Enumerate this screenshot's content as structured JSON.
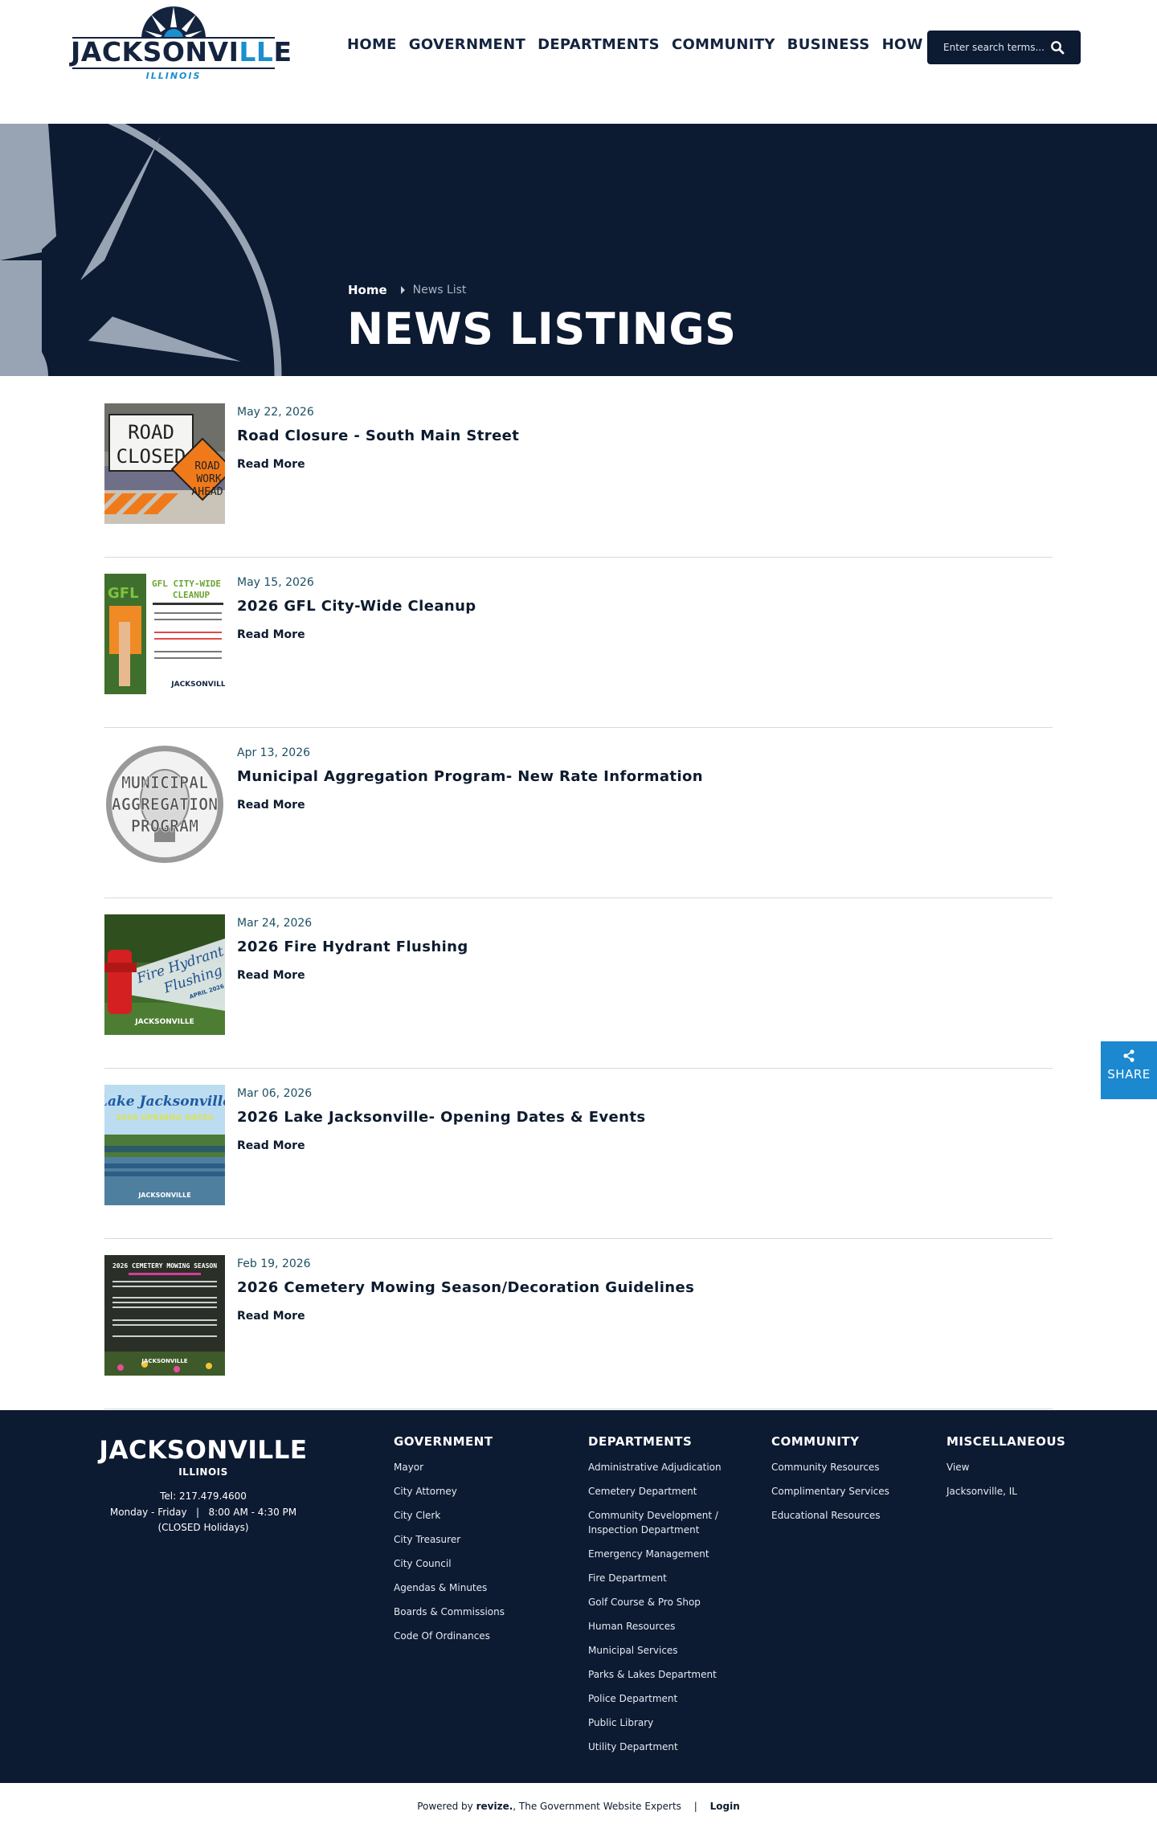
{
  "header": {
    "logo_word_a": "JACKSONVI",
    "logo_word_b": "LL",
    "logo_word_c": "E",
    "logo_sub": "ILLINOIS",
    "nav": [
      "HOME",
      "GOVERNMENT",
      "DEPARTMENTS",
      "COMMUNITY",
      "BUSINESS",
      "HOW DO I"
    ],
    "search_placeholder": "Enter search terms..."
  },
  "hero": {
    "breadcrumb_home": "Home",
    "breadcrumb_current": "News List",
    "title": "NEWS LISTINGS"
  },
  "news": [
    {
      "date": "May 22, 2026",
      "title": "Road Closure - South Main Street",
      "more": "Read More",
      "thumb_text": [
        "ROAD",
        "CLOSED",
        "ROAD",
        "WORK",
        "AHEAD"
      ]
    },
    {
      "date": "May 15, 2026",
      "title": "2026 GFL City-Wide Cleanup",
      "more": "Read More",
      "thumb_text": [
        "GFL CITY-WIDE",
        "CLEANUP",
        "JACKSONVILLE"
      ]
    },
    {
      "date": "Apr 13, 2026",
      "title": "Municipal Aggregation Program- New Rate Information",
      "more": "Read More",
      "thumb_text": [
        "MUNICIPAL",
        "AGGREGATION",
        "PROGRAM"
      ]
    },
    {
      "date": "Mar 24, 2026",
      "title": "2026 Fire Hydrant Flushing",
      "more": "Read More",
      "thumb_text": [
        "Fire Hydrant",
        "Flushing",
        "APRIL 2026",
        "JACKSONVILLE"
      ]
    },
    {
      "date": "Mar 06, 2026",
      "title": "2026 Lake Jacksonville- Opening Dates & Events",
      "more": "Read More",
      "thumb_text": [
        "Lake Jacksonville",
        "2026 OPENING DATES",
        "JACKSONVILLE"
      ]
    },
    {
      "date": "Feb 19, 2026",
      "title": "2026 Cemetery Mowing Season/Decoration Guidelines",
      "more": "Read More",
      "thumb_text": [
        "2026 CEMETERY MOWING SEASON",
        "JACKSONVILLE"
      ]
    }
  ],
  "share": {
    "label": "SHARE"
  },
  "footer": {
    "name": "JACKSONVILLE",
    "state": "ILLINOIS",
    "tel": "Tel: 217.479.4600",
    "hours": "Monday - Friday   |   8:00 AM - 4:30 PM",
    "closed": "(CLOSED Holidays)",
    "columns": [
      {
        "heading": "GOVERNMENT",
        "links": [
          "Mayor",
          "City Attorney",
          "City Clerk",
          "City Treasurer",
          "City Council",
          "Agendas & Minutes",
          "Boards & Commissions",
          "Code Of Ordinances"
        ]
      },
      {
        "heading": "DEPARTMENTS",
        "links": [
          "Administrative Adjudication",
          "Cemetery Department",
          "Community Development / Inspection Department",
          "Emergency Management",
          "Fire Department",
          "Golf Course & Pro Shop",
          "Human Resources",
          "Municipal Services",
          "Parks & Lakes Department",
          "Police Department",
          "Public Library",
          "Utility Department"
        ]
      },
      {
        "heading": "COMMUNITY",
        "links": [
          "Community Resources",
          "Complimentary Services",
          "Educational Resources"
        ]
      },
      {
        "heading": "MISCELLANEOUS",
        "links": [
          "View",
          "Jacksonville, IL"
        ]
      }
    ]
  },
  "bottom": {
    "powered": "Powered by",
    "brand": "revize.",
    "tagline": "The Government Website Experts",
    "login": "Login"
  },
  "colors": {
    "navy": "#0c1a32",
    "accent_blue": "#1b88cf",
    "compass_gray": "#98a4b4"
  }
}
